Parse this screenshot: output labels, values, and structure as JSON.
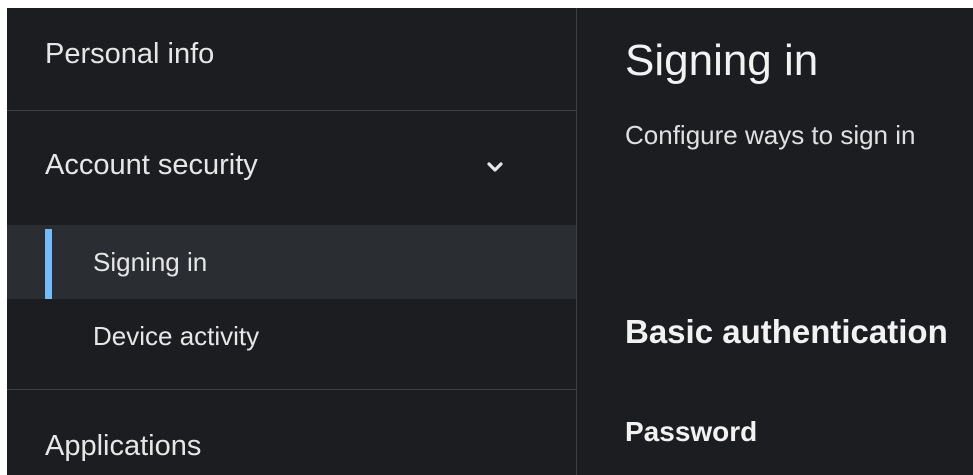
{
  "sidebar": {
    "personal_info": "Personal info",
    "account_security": {
      "label": "Account security",
      "icon": "chevron-down-icon",
      "items": [
        {
          "label": "Signing in",
          "active": true
        },
        {
          "label": "Device activity",
          "active": false
        }
      ]
    },
    "applications": "Applications"
  },
  "main": {
    "title": "Signing in",
    "description": "Configure ways to sign in",
    "section_title": "Basic authentication",
    "subsection_title": "Password"
  },
  "colors": {
    "background": "#1b1d21",
    "active_item_bg": "#2a2d31",
    "accent": "#73bcf7",
    "divider": "#3c3f42"
  }
}
